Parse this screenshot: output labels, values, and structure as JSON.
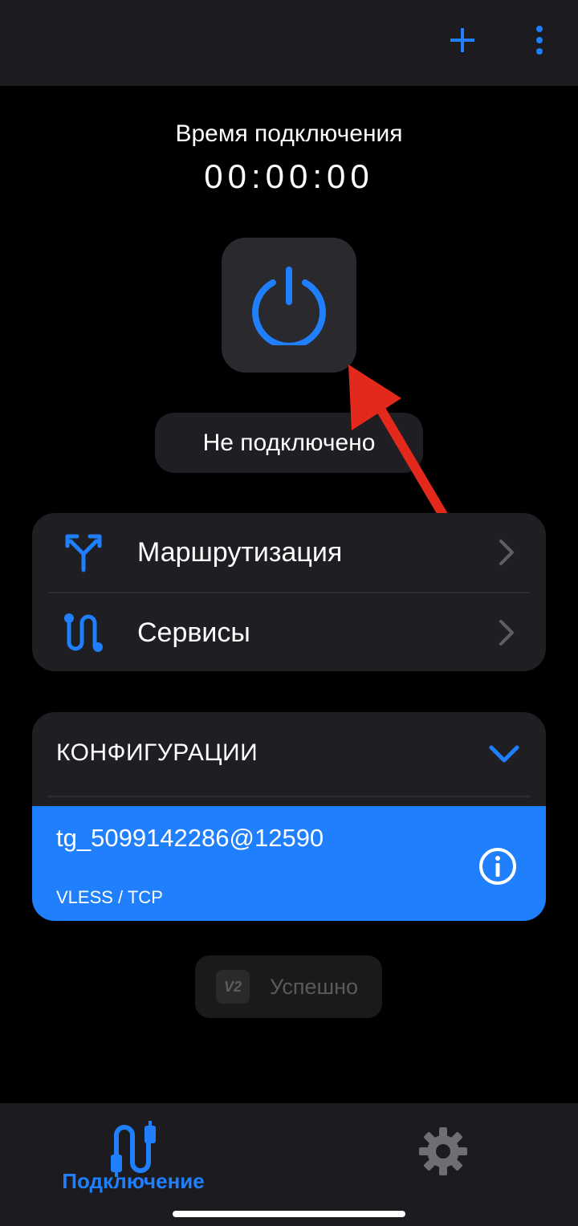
{
  "topbar": {
    "add_icon": "plus-icon",
    "menu_icon": "more-vert-icon"
  },
  "timer": {
    "label": "Время подключения",
    "value": "00:00:00"
  },
  "power": {
    "icon": "power-icon"
  },
  "status": {
    "text": "Не подключено"
  },
  "menu": {
    "items": [
      {
        "label": "Маршрутизация",
        "icon": "routing-icon"
      },
      {
        "label": "Сервисы",
        "icon": "services-icon"
      }
    ]
  },
  "configs": {
    "title": "КОНФИГУРАЦИИ",
    "items": [
      {
        "name": "tg_5099142286@12590",
        "protocol": "VLESS / TCP",
        "selected": true
      }
    ]
  },
  "toast": {
    "logo": "V2",
    "text": "Успешно"
  },
  "bottom_nav": {
    "tabs": [
      {
        "label": "Подключение",
        "icon": "connection-icon",
        "active": true
      },
      {
        "label": "",
        "icon": "gear-icon",
        "active": false
      }
    ]
  },
  "colors": {
    "accent": "#1f7ffd",
    "background": "#000000",
    "surface": "#1f1e23",
    "annotation_arrow": "#e3291b"
  }
}
